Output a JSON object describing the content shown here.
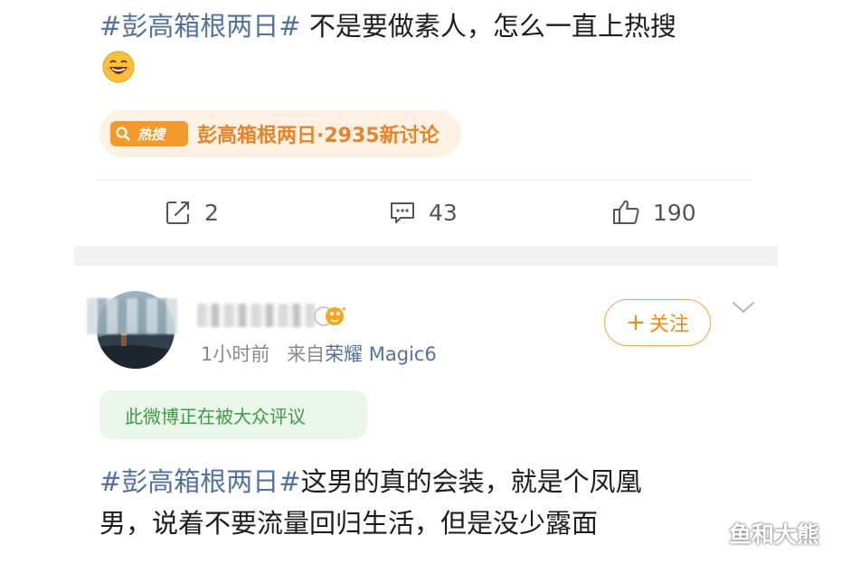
{
  "post1": {
    "hashtag": "#彭高箱根两日#",
    "text": " 不是要做素人，怎么一直上热搜",
    "emoji": "laughing-face-emoji",
    "hot_badge_label": "热搜",
    "hot_chip_text": "彭高箱根两日·2935新讨论",
    "actions": {
      "repost_count": "2",
      "comment_count": "43",
      "like_count": "190"
    }
  },
  "post2": {
    "meta_time": "1小时前",
    "meta_from": "来自",
    "meta_source": "荣耀 Magic6",
    "follow_label": "关注",
    "discussion_tag": "此微博正在被大众评议",
    "hashtag": "#彭高箱根两日#",
    "text_line1": "这男的真的会装，就是个凤凰",
    "text_line2": "男，说着不要流量回归生活，但是没少露面"
  },
  "watermark": "鱼和大熊",
  "colors": {
    "hashtag": "#53729e",
    "hot_orange": "#f39a2b",
    "follow_orange": "#ea8a20",
    "discuss_green": "#3f9a45"
  }
}
